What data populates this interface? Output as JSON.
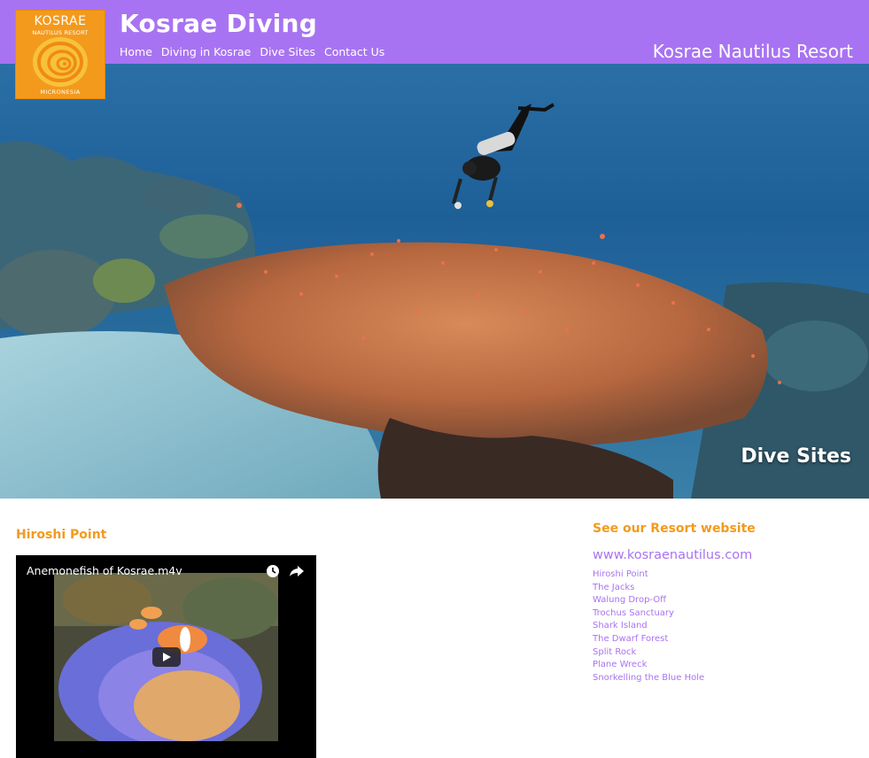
{
  "logo": {
    "title": "KOSRAE",
    "subtitle": "NAUTILUS RESORT",
    "footer": "MICRONESIA"
  },
  "header": {
    "site_title": "Kosrae Diving",
    "resort_name": "Kosrae Nautilus Resort",
    "nav": [
      {
        "label": "Home"
      },
      {
        "label": "Diving in Kosrae"
      },
      {
        "label": "Dive Sites"
      },
      {
        "label": "Contact Us"
      }
    ]
  },
  "hero": {
    "caption": "Dive Sites"
  },
  "main": {
    "section_title": "Hiroshi Point",
    "video": {
      "title": "Anemonefish of Kosrae.m4v"
    }
  },
  "sidebar": {
    "title": "See our Resort website",
    "link": "www.kosraenautilus.com",
    "sites": [
      {
        "label": "Hiroshi Point"
      },
      {
        "label": "The Jacks"
      },
      {
        "label": "Walung Drop-Off"
      },
      {
        "label": "Trochus Sanctuary"
      },
      {
        "label": "Shark Island"
      },
      {
        "label": "The Dwarf Forest"
      },
      {
        "label": "Split Rock"
      },
      {
        "label": "Plane Wreck"
      },
      {
        "label": "Snorkelling the Blue Hole"
      }
    ]
  },
  "colors": {
    "header_bg": "#a873f2",
    "accent_orange": "#f39a1d",
    "link_purple": "#a873f2"
  }
}
